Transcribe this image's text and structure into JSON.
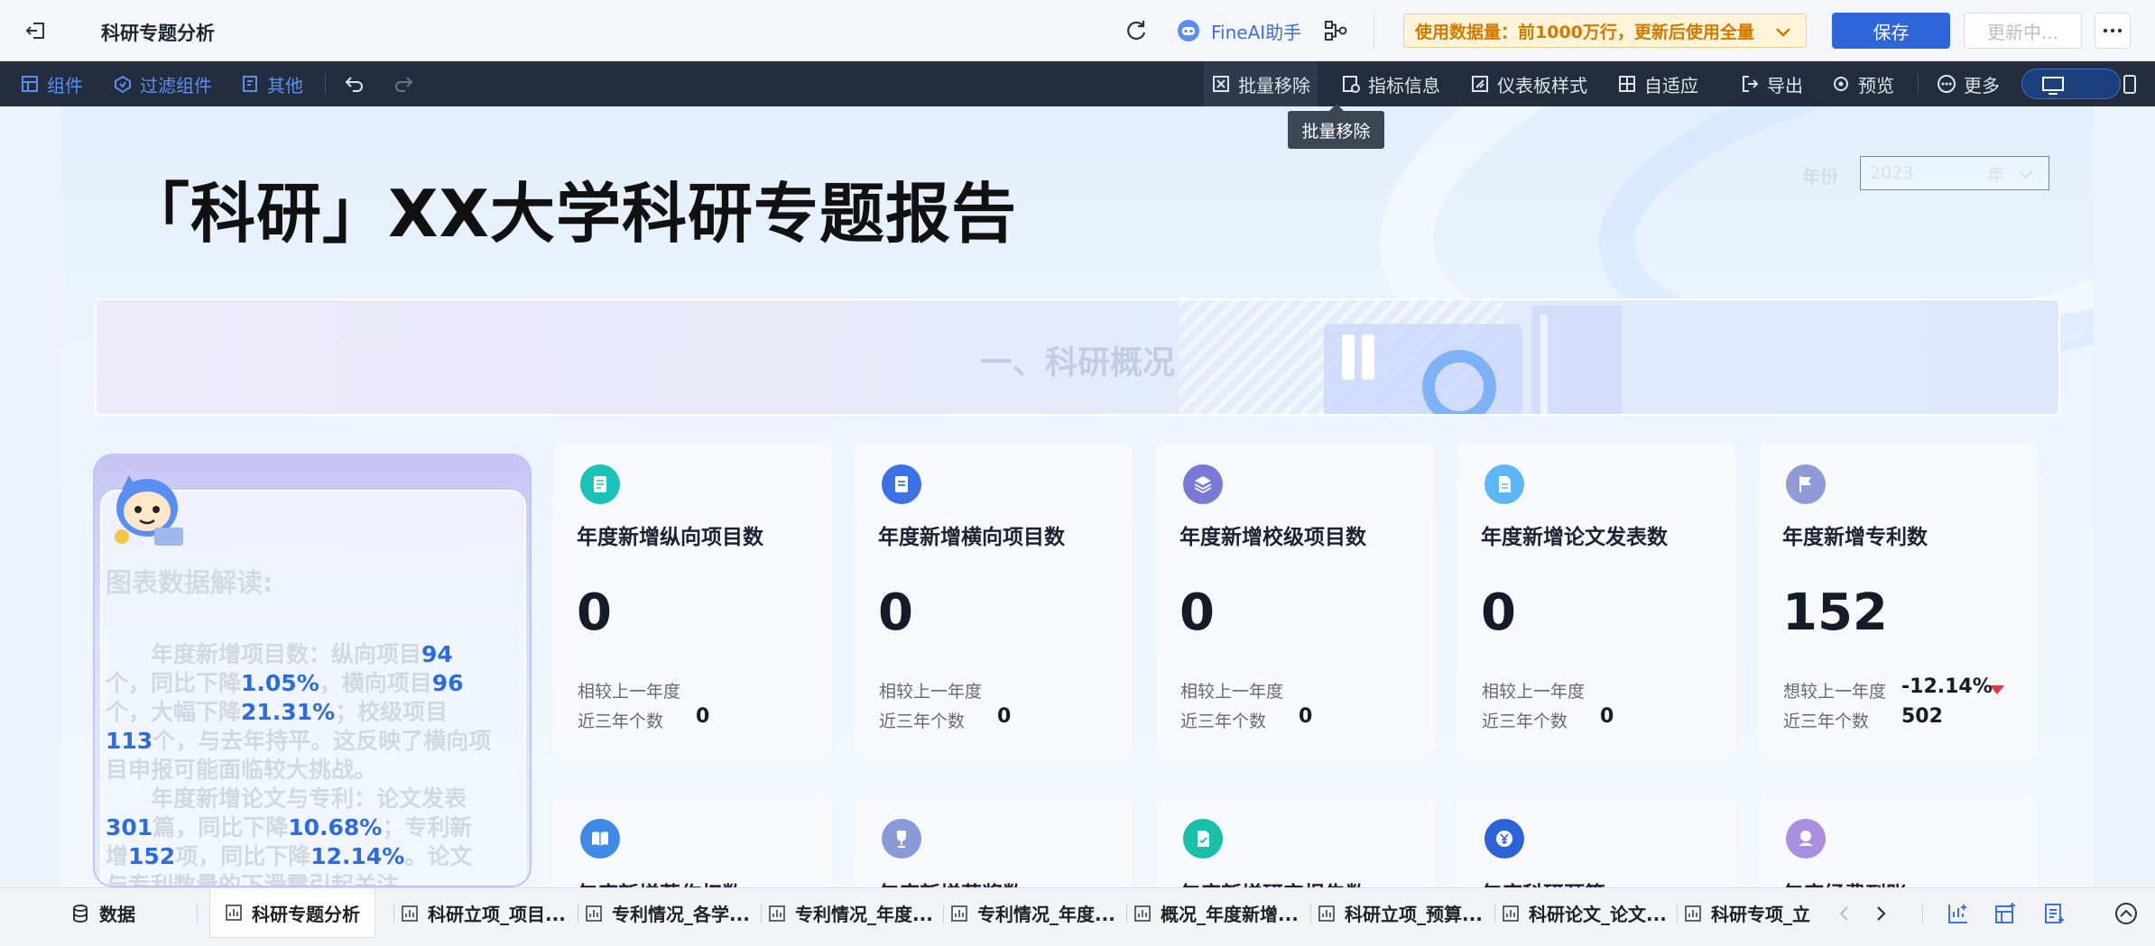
{
  "topbar": {
    "title": "科研专题分析",
    "ai_label": "FineAI助手",
    "usage_text": "使用数据量：前1000万行，更新后使用全量",
    "save_label": "保存",
    "update_label": "更新中..."
  },
  "toolbar": {
    "left": [
      {
        "label": "组件",
        "icon": "component-icon"
      },
      {
        "label": "过滤组件",
        "icon": "filter-component-icon"
      },
      {
        "label": "其他",
        "icon": "other-icon"
      }
    ],
    "right": [
      {
        "label": "批量移除",
        "icon": "batch-remove-icon"
      },
      {
        "label": "指标信息",
        "icon": "indicator-info-icon"
      },
      {
        "label": "仪表板样式",
        "icon": "dashboard-style-icon"
      },
      {
        "label": "自适应",
        "icon": "adaptive-icon"
      },
      {
        "label": "导出",
        "icon": "export-icon"
      },
      {
        "label": "预览",
        "icon": "preview-icon"
      },
      {
        "label": "更多",
        "icon": "more-icon"
      }
    ],
    "tooltip": "批量移除"
  },
  "dashboard": {
    "title": "「科研」XX大学科研专题报告",
    "year_label": "年份",
    "year_value": "2023",
    "year_unit": "年",
    "section_title": "一、科研概况"
  },
  "explanation": {
    "heading": "图表数据解读:",
    "p1": [
      {
        "t": "年度新增项目数",
        "c": "k"
      },
      {
        "t": "：纵向项目",
        "c": ""
      },
      {
        "t": "94",
        "c": "n"
      },
      {
        "t": "个，同比下降",
        "c": ""
      },
      {
        "t": "1.05%",
        "c": "n"
      },
      {
        "t": "，横向项目",
        "c": ""
      },
      {
        "t": "96",
        "c": "n"
      },
      {
        "t": "个，大幅下降",
        "c": ""
      },
      {
        "t": "21.31%",
        "c": "n"
      },
      {
        "t": "；校级项目",
        "c": ""
      },
      {
        "t": "113",
        "c": "n"
      },
      {
        "t": "个，与去年持平。这反映了横向项目申报可能面临较大挑战。",
        "c": ""
      }
    ],
    "p2": [
      {
        "t": "年度新增论文与专利",
        "c": "k"
      },
      {
        "t": "：论文发表",
        "c": ""
      },
      {
        "t": "301",
        "c": "n"
      },
      {
        "t": "篇，同比下降",
        "c": ""
      },
      {
        "t": "10.68%",
        "c": "n"
      },
      {
        "t": "；专利新增",
        "c": ""
      },
      {
        "t": "152",
        "c": "n"
      },
      {
        "t": "项，同比下降",
        "c": ""
      },
      {
        "t": "12.14%",
        "c": "n"
      },
      {
        "t": "。论文与专利数量的下滑需引起关注。",
        "c": ""
      }
    ]
  },
  "kpis": [
    {
      "name": "年度新增纵向项目数",
      "value": "0",
      "cmp_label": "相较上一年度",
      "cmp_value": "",
      "near_label": "近三年个数",
      "near_value": "0",
      "icon": "clipboard-icon",
      "color": "#19c3b8"
    },
    {
      "name": "年度新增横向项目数",
      "value": "0",
      "cmp_label": "相较上一年度",
      "cmp_value": "",
      "near_label": "近三年个数",
      "near_value": "0",
      "icon": "document-list-icon",
      "color": "#3c72e6"
    },
    {
      "name": "年度新增校级项目数",
      "value": "0",
      "cmp_label": "相较上一年度",
      "cmp_value": "",
      "near_label": "近三年个数",
      "near_value": "0",
      "icon": "layers-icon",
      "color": "#7b79d6"
    },
    {
      "name": "年度新增论文发表数",
      "value": "0",
      "cmp_label": "相较上一年度",
      "cmp_value": "",
      "near_label": "近三年个数",
      "near_value": "0",
      "icon": "paper-icon",
      "color": "#5db6f5"
    },
    {
      "name": "年度新增专利数",
      "value": "152",
      "cmp_label": "想较上一年度",
      "cmp_value": "-12.14%",
      "near_label": "近三年个数",
      "near_value": "502",
      "icon": "flag-icon",
      "color": "#8f9bd6",
      "trend": "down"
    }
  ],
  "kpis_row2": [
    {
      "name": "年度新增著作权数",
      "icon": "book-icon",
      "color": "#3f8ae8"
    },
    {
      "name": "年度新增获奖数",
      "icon": "trophy-icon",
      "color": "#8a99d8"
    },
    {
      "name": "年度新增研究报告数",
      "icon": "report-icon",
      "color": "#19bfa8"
    },
    {
      "name": "年度科研预算",
      "icon": "yuan-icon",
      "color": "#2d63d9"
    },
    {
      "name": "年度经费到账",
      "icon": "funds-icon",
      "color": "#a88fe0"
    }
  ],
  "sheets": {
    "data_label": "数据",
    "tabs": [
      "科研专题分析",
      "科研立项_项目...",
      "专利情况_各学...",
      "专利情况_年度...",
      "专利情况_年度...",
      "概况_年度新增...",
      "科研立项_预算...",
      "科研论文_论文...",
      "科研专项_立"
    ]
  },
  "colors": {
    "primary": "#2e66da",
    "toolbar_bg": "#232d3d",
    "warning_bg": "#fff3d9",
    "warning_text": "#d07a00",
    "negative": "#e3383f"
  }
}
